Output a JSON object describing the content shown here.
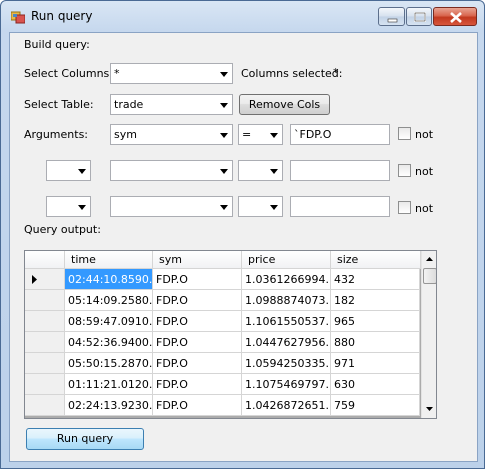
{
  "window": {
    "title": "Run query"
  },
  "labels": {
    "build_query": "Build query:",
    "select_columns": "Select Columns:",
    "columns_selected": "Columns selected:",
    "columns_selected_value": "*",
    "select_table": "Select Table:",
    "arguments": "Arguments:",
    "query_output": "Query output:"
  },
  "fields": {
    "columns_value": "*",
    "table_value": "trade",
    "arg1_column": "sym",
    "arg1_operator": "=",
    "arg1_value": "`FDP.O",
    "arg2_logic": "",
    "arg2_column": "",
    "arg2_operator": "",
    "arg2_value": "",
    "arg3_logic": "",
    "arg3_column": "",
    "arg3_operator": "",
    "arg3_value": ""
  },
  "checkbox_labels": {
    "not1": "not",
    "not2": "not",
    "not3": "not"
  },
  "buttons": {
    "remove_cols": "Remove Cols",
    "run_query": "Run query"
  },
  "grid": {
    "columns": [
      "time",
      "sym",
      "price",
      "size"
    ],
    "rows": [
      [
        "02:44:10.8590...",
        "FDP.O",
        "1.0361266994...",
        "432"
      ],
      [
        "05:14:09.2580...",
        "FDP.O",
        "1.0988874073...",
        "182"
      ],
      [
        "08:59:47.0910...",
        "FDP.O",
        "1.1061550537...",
        "965"
      ],
      [
        "04:52:36.9400...",
        "FDP.O",
        "1.0447627956...",
        "880"
      ],
      [
        "05:50:15.2870...",
        "FDP.O",
        "1.0594250335...",
        "971"
      ],
      [
        "01:11:21.0120...",
        "FDP.O",
        "1.1075469797...",
        "630"
      ],
      [
        "02:24:13.9230...",
        "FDP.O",
        "1.0426872651...",
        "759"
      ]
    ]
  },
  "icons": {
    "app": "database-query-icon",
    "current_row": "row-pointer-icon",
    "dropdown": "chevron-down-icon"
  }
}
